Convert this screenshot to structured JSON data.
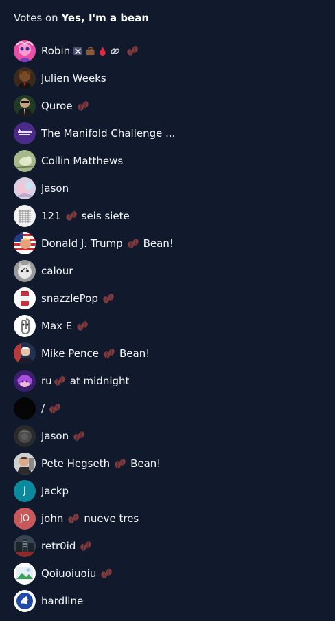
{
  "header": {
    "prefix": "Votes on",
    "answer": "Yes, I'm a bean"
  },
  "colors": {
    "background": "#111a2c",
    "bean": "#7d3b3f",
    "jackp_avatar": "#0b8a9e",
    "john_avatar": "#c9585a"
  },
  "voters": [
    {
      "name": "Robin",
      "bean": true,
      "suffix": "",
      "flair": [
        "crossed-swords-icon",
        "briefcase-icon",
        "drop-icon",
        "link-icon"
      ],
      "avatar": "avatar-pink"
    },
    {
      "name": "Julien Weeks",
      "bean": false,
      "suffix": "",
      "avatar": "avatar-bear"
    },
    {
      "name": "Quroe",
      "bean": true,
      "suffix": "",
      "avatar": "avatar-suit"
    },
    {
      "name": "The Manifold Challenge ...",
      "bean": false,
      "suffix": "",
      "avatar": "avatar-manifold"
    },
    {
      "name": "Collin Matthews",
      "bean": false,
      "suffix": "",
      "avatar": "avatar-bird"
    },
    {
      "name": "Jason",
      "bean": false,
      "suffix": "",
      "avatar": "avatar-pastel"
    },
    {
      "name": "121",
      "bean": true,
      "suffix": "seis siete",
      "avatar": "avatar-grid"
    },
    {
      "name": "Donald J. Trump",
      "bean": true,
      "suffix": "Bean!",
      "avatar": "avatar-flag"
    },
    {
      "name": "calour",
      "bean": false,
      "suffix": "",
      "avatar": "avatar-cat"
    },
    {
      "name": "snazzlePop",
      "bean": true,
      "suffix": "",
      "avatar": "avatar-can"
    },
    {
      "name": "Max E",
      "bean": true,
      "suffix": "",
      "avatar": "avatar-clip"
    },
    {
      "name": "Mike Pence",
      "bean": true,
      "suffix": "Bean!",
      "avatar": "avatar-pence"
    },
    {
      "name": "ru",
      "bean": true,
      "suffix": "at midnight",
      "avatar": "avatar-anime"
    },
    {
      "name": "/",
      "bean": true,
      "suffix": "",
      "avatar": "avatar-black"
    },
    {
      "name": "Jason",
      "bean": true,
      "suffix": "",
      "avatar": "avatar-dark"
    },
    {
      "name": "Pete Hegseth",
      "bean": true,
      "suffix": "Bean!",
      "avatar": "avatar-hegseth"
    },
    {
      "name": "Jackp",
      "bean": false,
      "suffix": "",
      "avatar": "avatar-letter",
      "initials": "J"
    },
    {
      "name": "john",
      "bean": true,
      "suffix": "nueve tres",
      "avatar": "avatar-letter",
      "initials": "JO"
    },
    {
      "name": "retr0id",
      "bean": true,
      "suffix": "",
      "avatar": "avatar-city"
    },
    {
      "name": "Qoiuoiuoiu",
      "bean": true,
      "suffix": "",
      "avatar": "avatar-placeholder"
    },
    {
      "name": "hardline",
      "bean": false,
      "suffix": "",
      "avatar": "avatar-hardline"
    }
  ]
}
